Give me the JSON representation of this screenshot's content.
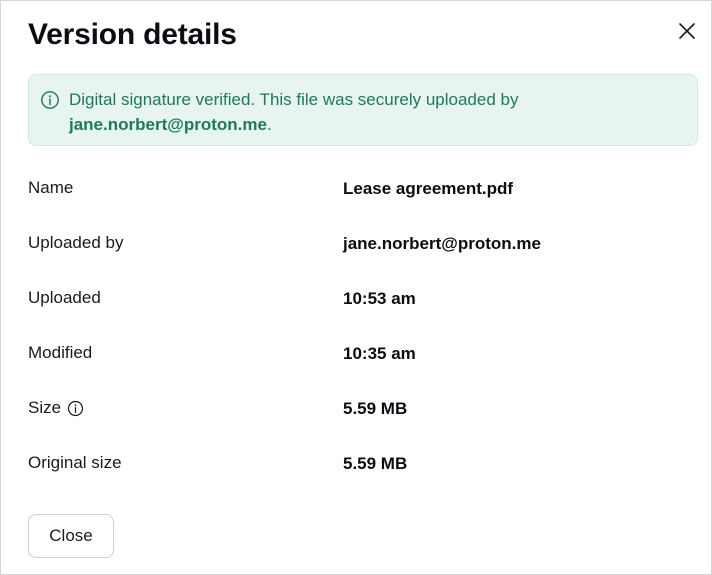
{
  "dialog": {
    "title": "Version details",
    "close_icon": "close-icon"
  },
  "banner": {
    "icon": "info-circle-icon",
    "text": "Digital signature verified. This file was securely uploaded by",
    "email": "jane.norbert@proton.me",
    "suffix": ".",
    "color": "#1c7a5c",
    "background": "#e7f4ef"
  },
  "details": [
    {
      "label": "Name",
      "value": "Lease agreement.pdf"
    },
    {
      "label": "Uploaded by",
      "value": "jane.norbert@proton.me"
    },
    {
      "label": "Uploaded",
      "value": "10:53 am"
    },
    {
      "label": "Modified",
      "value": "10:35 am"
    },
    {
      "label": "Size",
      "value": "5.59 MB",
      "info_icon": "info-circle-icon"
    },
    {
      "label": "Original size",
      "value": "5.59 MB"
    }
  ],
  "footer": {
    "close_label": "Close"
  }
}
